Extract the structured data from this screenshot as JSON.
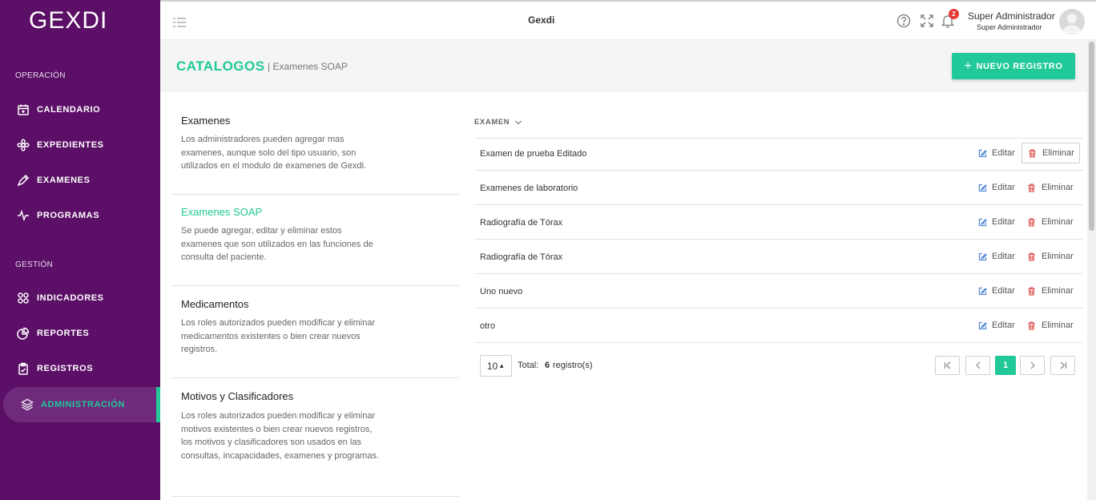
{
  "brand": {
    "logo_text": "GEXDI"
  },
  "sidebar": {
    "sections": [
      {
        "label": "OPERACIÓN"
      },
      {
        "label": "GESTIÓN"
      }
    ],
    "items": [
      {
        "label": "CALENDARIO",
        "icon": "calendar-icon"
      },
      {
        "label": "EXPEDIENTES",
        "icon": "flower-icon"
      },
      {
        "label": "EXAMENES",
        "icon": "pen-icon"
      },
      {
        "label": "PROGRAMAS",
        "icon": "pulse-icon"
      },
      {
        "label": "INDICADORES",
        "icon": "grid-icon"
      },
      {
        "label": "REPORTES",
        "icon": "pie-chart-icon"
      },
      {
        "label": "REGISTROS",
        "icon": "clipboard-icon"
      },
      {
        "label": "ADMINISTRACIÓN",
        "icon": "layers-icon",
        "active": true
      }
    ],
    "accent_color": "#20c997",
    "background_color": "#5b0f66"
  },
  "header": {
    "title": "Gexdi",
    "notification_count": "2",
    "user_name": "Super Administrador",
    "user_role": "Super Administrador"
  },
  "page": {
    "title": "CATALOGOS",
    "subtitle": "| Examenes SOAP",
    "new_button_label": "NUEVO REGISTRO"
  },
  "catalogs": [
    {
      "title": "Examenes",
      "description": "Los administradores pueden agregar mas examenes, aunque solo del tipo usuario, son utilizados en el modulo de examenes de Gexdi.",
      "active": false
    },
    {
      "title": "Examenes SOAP",
      "description": "Se puede agregar, editar y eliminar estos examenes que son utilizados en las funciones de consulta del paciente.",
      "active": true
    },
    {
      "title": "Medicamentos",
      "description": "Los roles autorizados pueden modificar y eliminar medicamentos existentes o bien crear nuevos registros.",
      "active": false
    },
    {
      "title": "Motivos y Clasificadores",
      "description": "Los roles autorizados pueden modificar y eliminar motivos existentes o bien crear nuevos registros, los motivos y clasificadores son usados en las consultas, incapacidades, examenes y programas.",
      "active": false
    }
  ],
  "table": {
    "column_header": "EXAMEN",
    "edit_label": "Editar",
    "delete_label": "Eliminar",
    "rows": [
      "Examen de prueba Editado",
      "Examenes de laboratorio",
      "Radiografía de Tórax",
      "Radiografía de Tórax",
      "Uno nuevo",
      "otro"
    ]
  },
  "pagination": {
    "page_size": "10",
    "total_label": "Total:",
    "total_count": "6",
    "total_unit": "registro(s)",
    "current_page": "1"
  }
}
